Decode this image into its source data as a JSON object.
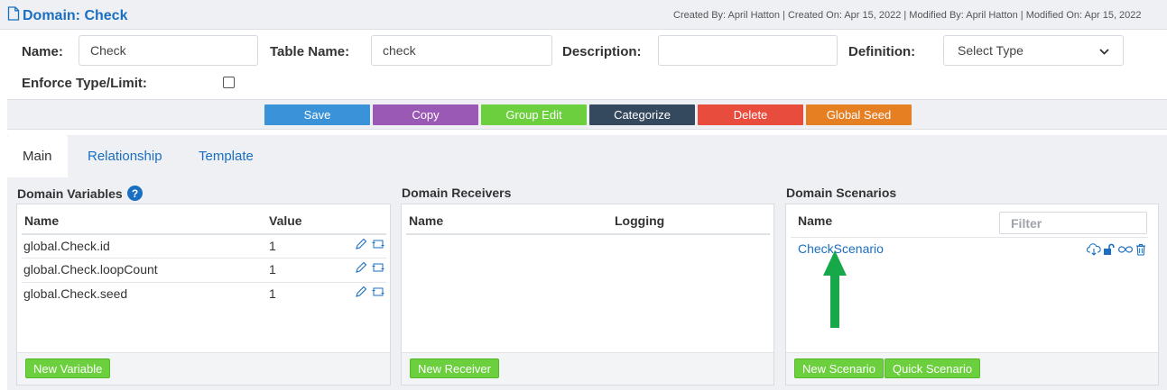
{
  "header": {
    "title": "Domain: Check",
    "meta": "Created By: April Hatton | Created On: Apr 15, 2022 | Modified By: April Hatton | Modified On: Apr 15, 2022"
  },
  "form": {
    "name_label": "Name:",
    "name_value": "Check",
    "table_name_label": "Table Name:",
    "table_name_value": "check",
    "description_label": "Description:",
    "description_value": "",
    "definition_label": "Definition:",
    "definition_selected": "Select Type",
    "enforce_label": "Enforce Type/Limit:",
    "enforce_checked": false
  },
  "toolbar": {
    "save": "Save",
    "copy": "Copy",
    "group_edit": "Group Edit",
    "categorize": "Categorize",
    "delete": "Delete",
    "global_seed": "Global Seed"
  },
  "colors": {
    "save": "#3a93d8",
    "copy": "#9b59b6",
    "group_edit": "#6ccf3e",
    "categorize": "#34495e",
    "delete": "#e74c3c",
    "global_seed": "#e67e22",
    "accent": "#1a6fc2",
    "new_button": "#6ccf3e",
    "arrow": "#17a84a"
  },
  "tabs": {
    "main": "Main",
    "relationship": "Relationship",
    "template": "Template",
    "active": "Main"
  },
  "variables": {
    "heading": "Domain Variables",
    "help_icon": "question-circle-icon",
    "col_name": "Name",
    "col_value": "Value",
    "rows": [
      {
        "name": "global.Check.id",
        "value": "1"
      },
      {
        "name": "global.Check.loopCount",
        "value": "1"
      },
      {
        "name": "global.Check.seed",
        "value": "1"
      }
    ],
    "row_icons": [
      "pencil-icon",
      "expand-icon"
    ],
    "new_button": "New Variable"
  },
  "receivers": {
    "heading": "Domain Receivers",
    "col_name": "Name",
    "col_logging": "Logging",
    "rows": [],
    "new_button": "New Receiver"
  },
  "scenarios": {
    "heading": "Domain Scenarios",
    "col_name": "Name",
    "filter_placeholder": "Filter",
    "rows": [
      {
        "name": "CheckScenario"
      }
    ],
    "row_icons": [
      "cloud-download-icon",
      "unlock-icon",
      "infinity-icon",
      "trash-icon"
    ],
    "new_button": "New Scenario",
    "quick_button": "Quick Scenario"
  }
}
